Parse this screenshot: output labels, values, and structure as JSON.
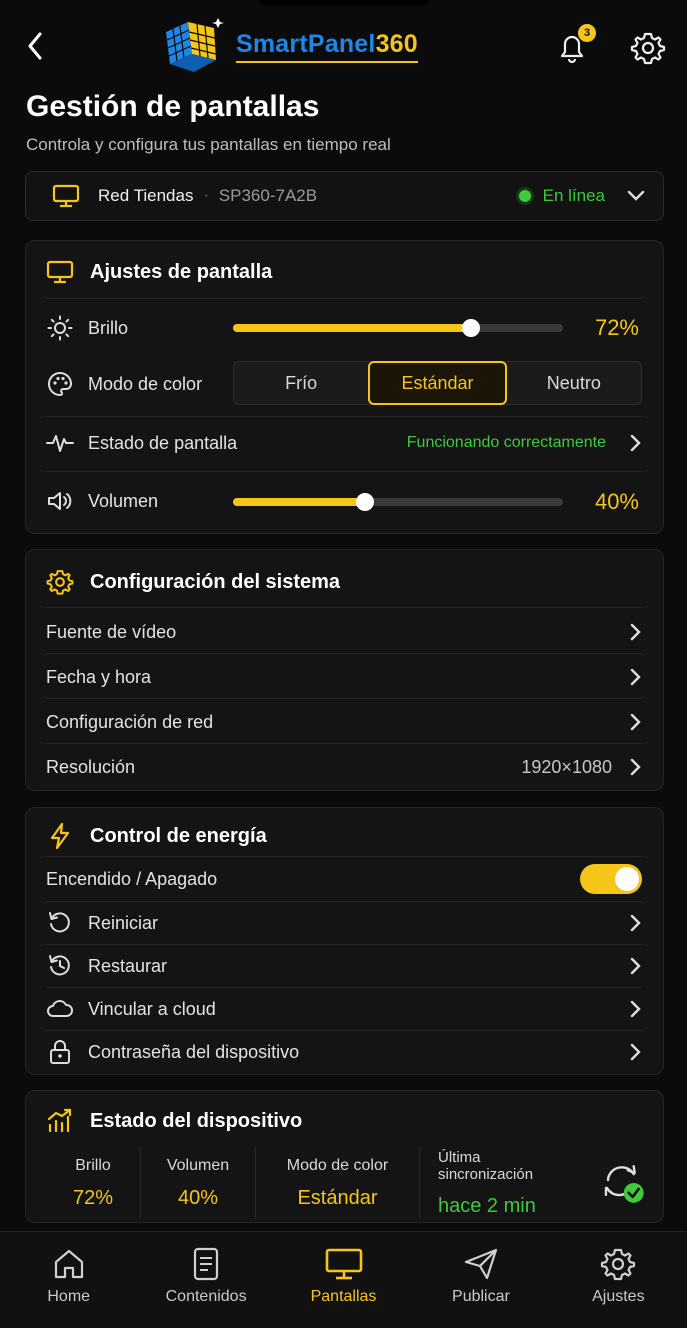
{
  "app": {
    "logo_text_a": "SmartPanel",
    "logo_text_b": "360",
    "notification_count": "3"
  },
  "page": {
    "title": "Gestión de pantallas",
    "subtitle": "Controla y configura tus pantallas en tiempo real"
  },
  "device": {
    "name": "Red Tiendas",
    "separator": "·",
    "code": "SP360-7A2B",
    "status": "En línea"
  },
  "display_settings": {
    "title": "Ajustes de pantalla",
    "brightness_label": "Brillo",
    "brightness_value": "72%",
    "brightness_level": 0.72,
    "color_mode_label": "Modo de color",
    "color_modes": [
      "Frío",
      "Estándar",
      "Neutro"
    ],
    "color_mode_selected": "Estándar",
    "screen_state_label": "Estado de pantalla",
    "screen_state_value": "Funcionando correctamente",
    "volume_label": "Volumen",
    "volume_value": "40%",
    "volume_level": 0.4
  },
  "system_config": {
    "title": "Configuración del sistema",
    "items": [
      {
        "label": "Fuente de vídeo",
        "value": ""
      },
      {
        "label": "Fecha y hora",
        "value": ""
      },
      {
        "label": "Configuración de red",
        "value": ""
      },
      {
        "label": "Resolución",
        "value": "1920×1080"
      }
    ]
  },
  "power": {
    "title": "Control de energía",
    "power_toggle_label": "Encendido / Apagado",
    "power_on": true,
    "items": [
      {
        "label": "Reiniciar",
        "icon": "restart-icon"
      },
      {
        "label": "Restaurar",
        "icon": "history-icon"
      },
      {
        "label": "Vincular a cloud",
        "icon": "cloud-icon"
      },
      {
        "label": "Contraseña del dispositivo",
        "icon": "lock-icon"
      }
    ]
  },
  "device_status": {
    "title": "Estado del dispositivo",
    "stats": [
      {
        "label": "Brillo",
        "value": "72%"
      },
      {
        "label": "Volumen",
        "value": "40%"
      },
      {
        "label": "Modo de color",
        "value": "Estándar"
      },
      {
        "label": "Última sincronización",
        "value": "hace 2 min"
      }
    ]
  },
  "nav": {
    "items": [
      {
        "label": "Home",
        "icon": "home-icon"
      },
      {
        "label": "Contenidos",
        "icon": "document-icon"
      },
      {
        "label": "Pantallas",
        "icon": "monitor-icon"
      },
      {
        "label": "Publicar",
        "icon": "send-icon"
      },
      {
        "label": "Ajustes",
        "icon": "gear-icon"
      }
    ],
    "active": "Pantallas"
  },
  "colors": {
    "accent": "#f5c518",
    "success": "#3ec93e",
    "brand_blue": "#1f86e6",
    "background": "#0b0b0b"
  }
}
